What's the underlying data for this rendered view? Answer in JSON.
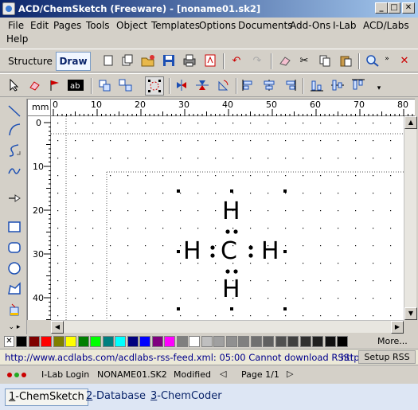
{
  "window": {
    "title": "ACD/ChemSketch (Freeware) - [noname01.sk2]",
    "buttons": [
      "_",
      "□",
      "✕"
    ]
  },
  "menu": {
    "items": [
      "File",
      "Edit",
      "Pages",
      "Tools",
      "Object",
      "Templates",
      "Options",
      "Documents",
      "Add-Ons",
      "I-Lab",
      "ACD/Labs",
      "Help"
    ]
  },
  "toolbar1": {
    "mode_structure": "Structure",
    "mode_draw": "Draw"
  },
  "ruler": {
    "unit": "mm",
    "h_ticks": [
      "0",
      "10",
      "20",
      "30",
      "40",
      "50",
      "60",
      "70",
      "80"
    ],
    "v_ticks": [
      "0",
      "10",
      "20",
      "30",
      "40"
    ]
  },
  "molecule": {
    "center": "C",
    "top": "H",
    "bottom": "H",
    "left": "H",
    "right": "H",
    "electron_dot": "•"
  },
  "colors": {
    "swatches": [
      "#000000",
      "#7f0000",
      "#ff0000",
      "#7f7f00",
      "#ffff00",
      "#007f00",
      "#00ff00",
      "#007f7f",
      "#00ffff",
      "#00007f",
      "#0000ff",
      "#7f007f",
      "#ff00ff",
      "#7f7f7f",
      "#ffffff",
      "#bfbfbf",
      "#a0a0a0",
      "#909090",
      "#808080",
      "#707070",
      "#606060",
      "#505050",
      "#404040",
      "#303030",
      "#202020",
      "#101010",
      "#000000"
    ],
    "more_label": "More..."
  },
  "rss": {
    "message": "http://www.acdlabs.com/acdlabs-rss-feed.xml: 05:00 Cannot download RSS!",
    "trailing": "http",
    "setup_label": "Setup RSS"
  },
  "status": {
    "ilab": "I-Lab Login",
    "doc": "NONAME01.SK2",
    "modified": "Modified",
    "page": "Page 1/1"
  },
  "tabs": [
    {
      "num": "1",
      "label": "-ChemSketch"
    },
    {
      "num": "2",
      "label": "-Database"
    },
    {
      "num": "3",
      "label": "-ChemCoder"
    }
  ]
}
